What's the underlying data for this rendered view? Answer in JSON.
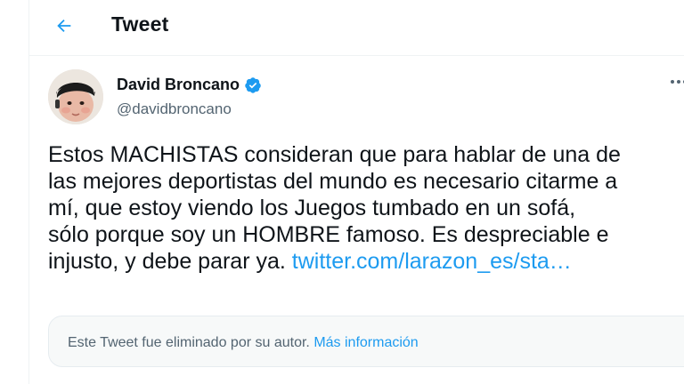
{
  "header": {
    "title": "Tweet",
    "back_icon": "arrow-left-icon",
    "accent_color": "#1d9bf0"
  },
  "tweet": {
    "author": {
      "display_name": "David Broncano",
      "handle": "@davidbroncano",
      "verified": true,
      "verified_icon": "verified-badge-icon"
    },
    "more_icon": "more-horizontal-icon",
    "text_lines": [
      "Estos MACHISTAS consideran que para hablar de una de",
      "las mejores deportistas del mundo es necesario citarme a",
      "mí, que estoy viendo los Juegos tumbado en un sofá,",
      "sólo porque soy un HOMBRE famoso. Es despreciable e",
      "injusto, y debe parar ya. "
    ],
    "link_text": "twitter.com/larazon_es/sta…",
    "quoted_notice": {
      "text": "Este Tweet fue eliminado por su autor. ",
      "link_text": "Más información"
    }
  }
}
